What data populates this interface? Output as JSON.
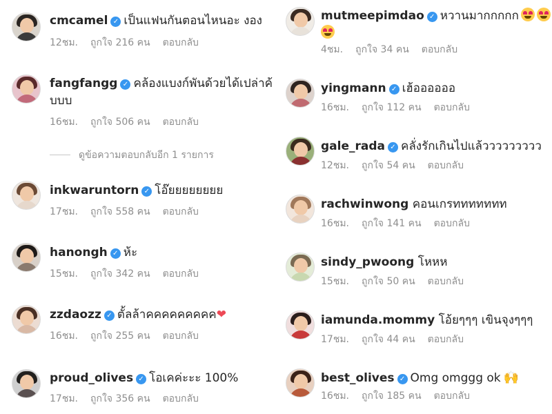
{
  "labels": {
    "like_prefix": "ถูกใจ",
    "like_suffix": "คน",
    "reply": "ตอบกลับ"
  },
  "view_replies": "ดูข้อความตอบกลับอีก 1 รายการ",
  "left_comments": [
    {
      "user": "cmcamel",
      "verified": true,
      "text": "เป็นแฟนกันตอนไหนอะ งอง",
      "time": "12ชม.",
      "likes": "216"
    },
    {
      "user": "fangfangg",
      "verified": true,
      "text": "คล้องแบงก์พันด้วยได้เปล่าค้",
      "text_cont": "บบบ",
      "time": "16ชม.",
      "likes": "506"
    },
    {
      "user": "inkwaruntorn",
      "verified": true,
      "text": "โอ๊ยยยยยยยย",
      "time": "17ชม.",
      "likes": "558"
    },
    {
      "user": "hanongh",
      "verified": true,
      "text": "ห้ะ",
      "time": "15ชม.",
      "likes": "342"
    },
    {
      "user": "zzdaozz",
      "verified": true,
      "text": "ตั้ลล้าคคคคคคคคค",
      "time": "16ชม.",
      "likes": "255",
      "emoji": "❤"
    },
    {
      "user": "proud_olives",
      "verified": true,
      "text": "โอเคค่ะะะ 100%",
      "time": "17ชม.",
      "likes": "356"
    }
  ],
  "right_comments": [
    {
      "user": "mutmeepimdao",
      "verified": true,
      "text": "หวานมากกกกก",
      "time": "4ชม.",
      "likes": "34"
    },
    {
      "user": "yingmann",
      "verified": true,
      "text": "เฮ้ออออออ",
      "time": "16ชม.",
      "likes": "112"
    },
    {
      "user": "gale_rada",
      "verified": true,
      "text": "คลั่งรักเกินไปแล้ววววววววว",
      "time": "12ชม.",
      "likes": "54"
    },
    {
      "user": "rachwinwong",
      "verified": false,
      "text": "คอนเกรททททททท",
      "time": "16ชม.",
      "likes": "141"
    },
    {
      "user": "sindy_pwoong",
      "verified": false,
      "text": "โหหห",
      "time": "15ชม.",
      "likes": "50"
    },
    {
      "user": "iamunda.mommy",
      "verified": false,
      "text": "โอ้ยๆๆๆ เขินจุงๆๆๆ",
      "time": "17ชม.",
      "likes": "44"
    },
    {
      "user": "best_olives",
      "verified": true,
      "text": "Omg omggg ok",
      "time": "16ชม.",
      "likes": "185",
      "emoji": "🙌"
    }
  ],
  "colors": {
    "verified": "#3897f0",
    "meta": "#8e8e8e",
    "text": "#262626",
    "heart": "#ed4956"
  }
}
